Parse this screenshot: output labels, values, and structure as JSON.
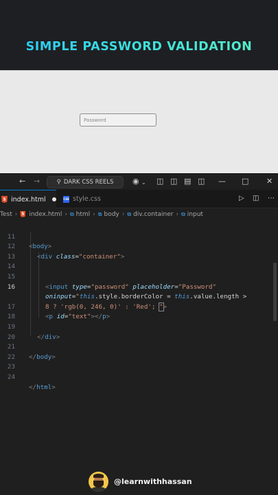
{
  "banner": {
    "title": "SIMPLE PASSWORD VALIDATION"
  },
  "preview": {
    "input_placeholder": "Password"
  },
  "titlebar": {
    "search_label": "DARK CSS REELS"
  },
  "tabs": [
    {
      "label": "index.html",
      "active": true,
      "modified": true
    },
    {
      "label": "style.css",
      "active": false
    }
  ],
  "breadcrumb": {
    "items": [
      "Test",
      "index.html",
      "html",
      "body",
      "div.container",
      "input"
    ]
  },
  "editor": {
    "line_numbers": [
      "11",
      "12",
      "13",
      "14",
      "15",
      "16",
      "",
      "17",
      "18",
      "19",
      "20",
      "21",
      "22",
      "23",
      "24"
    ],
    "current_line": "16"
  },
  "code": {
    "l11_tag": "body",
    "l13_tag": "div",
    "l13_attr": "class",
    "l13_val": "\"container\"",
    "l15_tag": "input",
    "l15_attr1": "type",
    "l15_val1": "\"password\"",
    "l15_attr2": "placeholder",
    "l15_val2": "\"Password\"",
    "l16_attr": "oninput",
    "l16_q": "\"",
    "l16_this1": "this",
    "l16_prop1": ".style.borderColor",
    "l16_eq": " = ",
    "l16_this2": "this",
    "l16_prop2": ".value.length",
    "l16_gt": " >",
    "l16b_code": "8 ? 'rgb(0, 246, 0)' : 'Red'; ",
    "l17_tag": "p",
    "l17_attr": "id",
    "l17_val": "\"text\"",
    "l19_tag": "div",
    "l21_tag": "body",
    "l24_tag": "html"
  },
  "watermark": {
    "handle": "@learnwithhassan"
  },
  "colors": {
    "accent_cyan": "#3fd6f0",
    "editor_bg": "#1f1f1f",
    "tag_blue": "#569cd6",
    "string": "#ce9178"
  }
}
